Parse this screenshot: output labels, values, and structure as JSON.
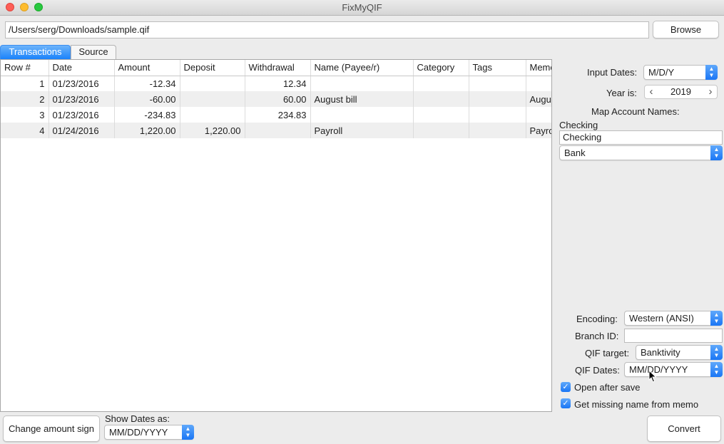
{
  "window": {
    "title": "FixMyQIF"
  },
  "file": {
    "path": "/Users/serg/Downloads/sample.qif",
    "browse_label": "Browse"
  },
  "tabs": [
    {
      "label": "Transactions",
      "active": true
    },
    {
      "label": "Source",
      "active": false
    }
  ],
  "table": {
    "columns": [
      "Row #",
      "Date",
      "Amount",
      "Deposit",
      "Withdrawal",
      "Name (Payee/r)",
      "Category",
      "Tags",
      "Memo"
    ],
    "rows": [
      {
        "row": "1",
        "date": "01/23/2016",
        "amount": "-12.34",
        "deposit": "",
        "withdrawal": "12.34",
        "name": "",
        "category": "",
        "tags": "",
        "memo": ""
      },
      {
        "row": "2",
        "date": "01/23/2016",
        "amount": "-60.00",
        "deposit": "",
        "withdrawal": "60.00",
        "name": "August bill",
        "category": "",
        "tags": "",
        "memo": "August bill"
      },
      {
        "row": "3",
        "date": "01/23/2016",
        "amount": "-234.83",
        "deposit": "",
        "withdrawal": "234.83",
        "name": "",
        "category": "",
        "tags": "",
        "memo": ""
      },
      {
        "row": "4",
        "date": "01/24/2016",
        "amount": "1,220.00",
        "deposit": "1,220.00",
        "withdrawal": "",
        "name": "Payroll",
        "category": "",
        "tags": "",
        "memo": "Payroll"
      }
    ]
  },
  "settings": {
    "input_dates_label": "Input Dates:",
    "input_dates_value": "M/D/Y",
    "year_label": "Year is:",
    "year_value": "2019",
    "map_accounts_label": "Map Account Names:",
    "account_name_label": "Checking",
    "account_name_value": "Checking",
    "account_type_value": "Bank",
    "encoding_label": "Encoding:",
    "encoding_value": "Western (ANSI)",
    "branch_label": "Branch ID:",
    "branch_value": "",
    "qif_target_label": "QIF target:",
    "qif_target_value": "Banktivity",
    "qif_dates_label": "QIF Dates:",
    "qif_dates_value": "MM/DD/YYYY",
    "open_after_save_label": "Open after save",
    "open_after_save_checked": true,
    "missing_name_label": "Get missing name from memo",
    "missing_name_checked": true
  },
  "bottom": {
    "change_sign_label": "Change amount sign",
    "show_dates_label": "Show Dates as:",
    "show_dates_value": "MM/DD/YYYY",
    "convert_label": "Convert"
  },
  "colors": {
    "accent": "#1a82fb"
  }
}
